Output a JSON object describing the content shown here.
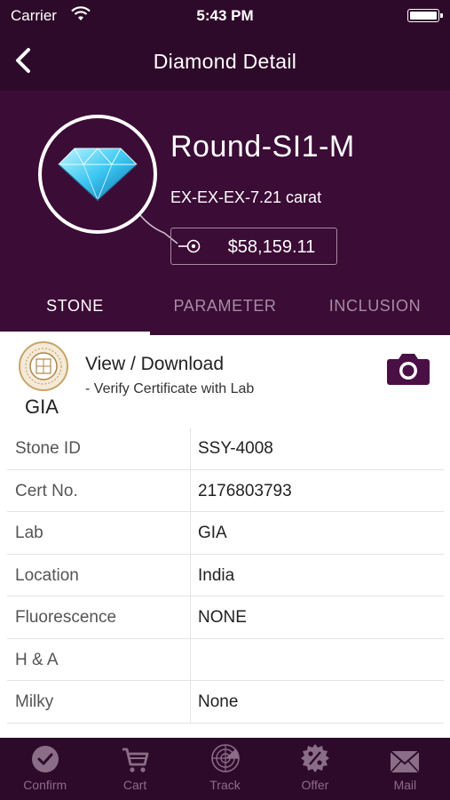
{
  "status_bar": {
    "carrier": "Carrier",
    "time": "5:43 PM"
  },
  "nav": {
    "title": "Diamond Detail"
  },
  "diamond": {
    "name": "Round-SI1-M",
    "spec": "EX-EX-EX-7.21 carat",
    "price": "$58,159.11"
  },
  "tabs": [
    {
      "label": "STONE",
      "active": true
    },
    {
      "label": "PARAMETER",
      "active": false
    },
    {
      "label": "INCLUSION",
      "active": false
    }
  ],
  "certificate": {
    "lab": "GIA",
    "title": "View / Download",
    "subtitle": "- Verify Certificate with Lab"
  },
  "details": [
    {
      "key": "Stone ID",
      "value": "SSY-4008"
    },
    {
      "key": "Cert No.",
      "value": "2176803793"
    },
    {
      "key": "Lab",
      "value": "GIA"
    },
    {
      "key": "Location",
      "value": "India"
    },
    {
      "key": "Fluorescence",
      "value": "NONE"
    },
    {
      "key": "H & A",
      "value": ""
    },
    {
      "key": "Milky",
      "value": "None"
    }
  ],
  "bottom_tabs": [
    {
      "label": "Confirm",
      "icon": "check-circle-icon"
    },
    {
      "label": "Cart",
      "icon": "cart-icon"
    },
    {
      "label": "Track",
      "icon": "radar-icon"
    },
    {
      "label": "Offer",
      "icon": "percent-badge-icon"
    },
    {
      "label": "Mail",
      "icon": "mail-icon"
    }
  ],
  "colors": {
    "header_bg": "#2e0a2a",
    "hero_bg": "#3b0c36",
    "accent": "#4a0f45",
    "inactive_tab": "#a78ca4"
  }
}
